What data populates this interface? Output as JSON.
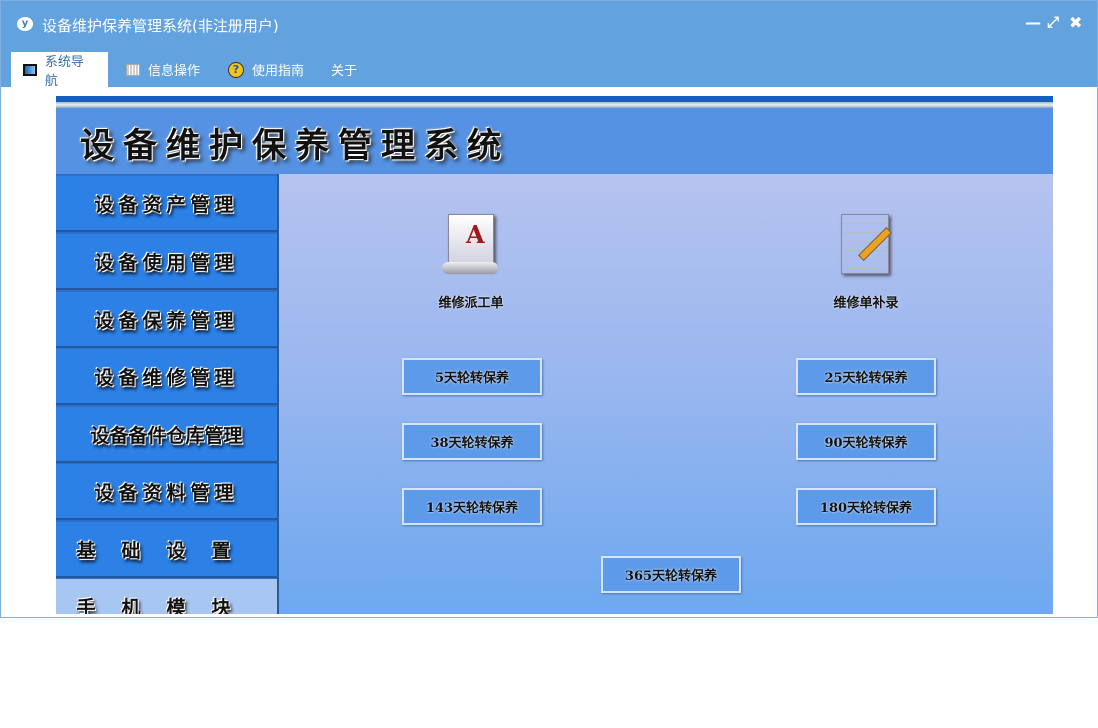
{
  "window": {
    "title": "设备维护保养管理系统(非注册用户)",
    "logo": "y"
  },
  "tabs": [
    {
      "label": "系统导航",
      "icon": "monitor-icon"
    },
    {
      "label": "信息操作",
      "icon": "grid-icon"
    },
    {
      "label": "使用指南",
      "icon": "help-icon"
    },
    {
      "label": "关于"
    }
  ],
  "header": {
    "title": "设备维护保养管理系统"
  },
  "sidebar": [
    "设备资产管理",
    "设备使用管理",
    "设备保养管理",
    "设备维修管理",
    "设备备件仓库管理",
    "设备资料管理",
    "基础设置",
    "手机模块"
  ],
  "main": {
    "icons": [
      {
        "label": "维修派工单",
        "icon": "document-a-icon"
      },
      {
        "label": "维修单补录",
        "icon": "edit-document-icon"
      }
    ],
    "buttons": [
      "5天轮转保养",
      "25天轮转保养",
      "38天轮转保养",
      "90天轮转保养",
      "143天轮转保养",
      "180天轮转保养",
      "365天轮转保养"
    ]
  }
}
